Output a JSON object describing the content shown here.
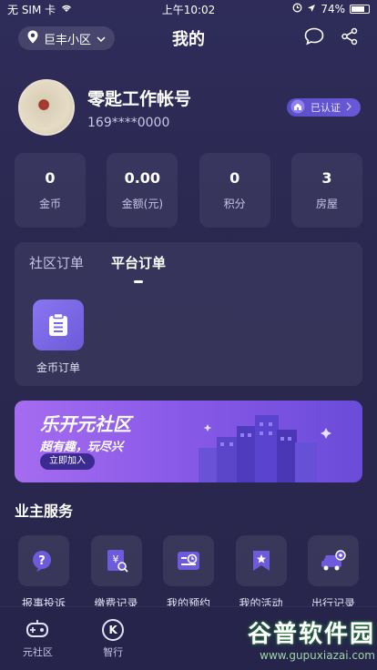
{
  "status_bar": {
    "carrier": "无 SIM 卡",
    "time": "上午10:02",
    "battery": "74%"
  },
  "nav": {
    "location": "巨丰小区",
    "title": "我的"
  },
  "profile": {
    "name": "零匙工作帐号",
    "phone": "169****0000",
    "verified_label": "已认证"
  },
  "stats": [
    {
      "value": "0",
      "label": "金币"
    },
    {
      "value": "0.00",
      "label": "金额(元)"
    },
    {
      "value": "0",
      "label": "积分"
    },
    {
      "value": "3",
      "label": "房屋"
    }
  ],
  "orders": {
    "tabs": [
      "社区订单",
      "平台订单"
    ],
    "active_tab": "平台订单",
    "items": [
      {
        "label": "金币订单",
        "icon": "clipboard-icon"
      }
    ]
  },
  "banner": {
    "title": "乐开元社区",
    "subtitle": "超有趣，玩尽兴",
    "button": "立即加入"
  },
  "services": {
    "title": "业主服务",
    "items": [
      {
        "label": "报事投诉",
        "icon": "question-bubble-icon"
      },
      {
        "label": "缴费记录",
        "icon": "bill-search-icon"
      },
      {
        "label": "我的预约",
        "icon": "calendar-clock-icon"
      },
      {
        "label": "我的活动",
        "icon": "bookmark-star-icon"
      },
      {
        "label": "出行记录",
        "icon": "car-icon"
      }
    ]
  },
  "tabbar": [
    {
      "label": "元社区",
      "icon": "gamepad-icon"
    },
    {
      "label": "智行",
      "icon": "k-icon",
      "glyph": "K"
    }
  ],
  "watermark": {
    "text": "谷普软件园",
    "url": "www.gupuxiazai.com"
  },
  "colors": {
    "background": "#2c2a52",
    "accent": "#7a66e8",
    "banner_start": "#a56cf0"
  }
}
